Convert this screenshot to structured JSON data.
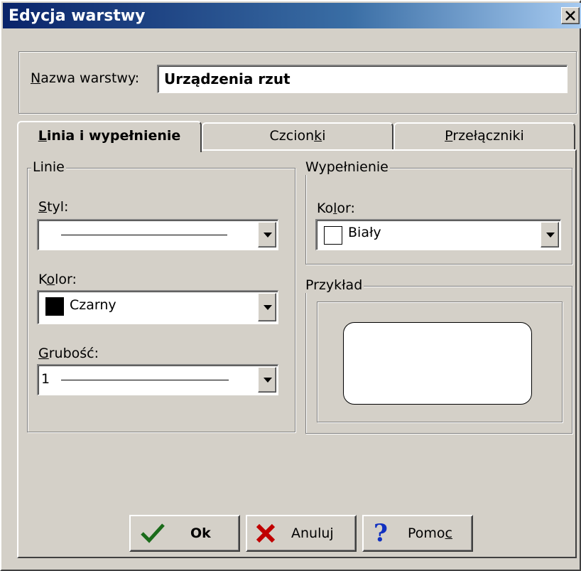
{
  "dialog": {
    "title": "Edycja warstwy",
    "close_label": "×"
  },
  "name_field": {
    "label": "Nazwa warstwy:",
    "value": "Urządzenia rzut"
  },
  "tabs": [
    {
      "label": "Linia i wypełnienie",
      "active": true
    },
    {
      "label": "Czcionki",
      "active": false
    },
    {
      "label": "Przełączniki",
      "active": false
    }
  ],
  "lines_group": {
    "title": "Linie",
    "style_label": "Styl:",
    "color_label": "Kolor:",
    "color_value": "Czarny",
    "color_swatch": "#000000",
    "width_label": "Grubość:",
    "width_value": "1"
  },
  "fill_group": {
    "title": "Wypełnienie",
    "color_label": "Kolor:",
    "color_value": "Biały",
    "color_swatch": "#ffffff"
  },
  "preview_group": {
    "title": "Przykład"
  },
  "buttons": {
    "ok": "Ok",
    "cancel": "Anuluj",
    "help": "Pomoc"
  },
  "icons": {
    "ok": "checkmark-icon",
    "cancel": "x-icon",
    "help": "question-icon",
    "accent_ok": "#1a6b1a",
    "accent_cancel": "#c00000",
    "accent_help": "#1030c0"
  }
}
